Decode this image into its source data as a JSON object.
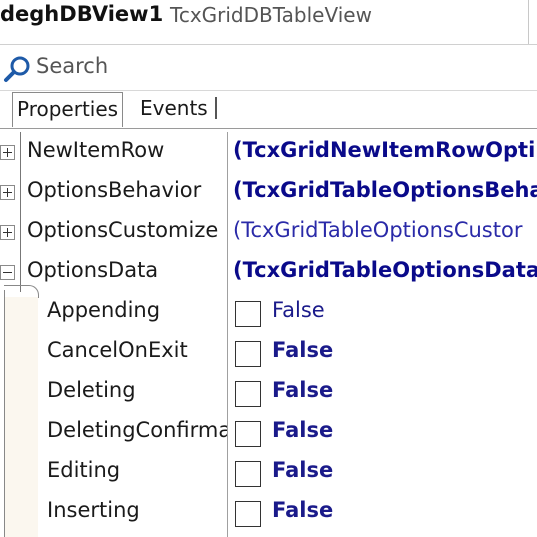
{
  "header": {
    "name": "deghDBView1",
    "type": "TcxGridDBTableView"
  },
  "search": {
    "placeholder": "Search"
  },
  "tabs": [
    {
      "label": "Properties",
      "active": true
    },
    {
      "label": "Events",
      "active": false
    }
  ],
  "properties": [
    {
      "name": "NewItemRow",
      "value": "(TcxGridNewItemRowOpti",
      "expander": "+",
      "bold": true
    },
    {
      "name": "OptionsBehavior",
      "value": "(TcxGridTableOptionsBehav",
      "expander": "+",
      "bold": true
    },
    {
      "name": "OptionsCustomize",
      "value": "(TcxGridTableOptionsCustor",
      "expander": "+",
      "bold": false
    },
    {
      "name": "OptionsData",
      "value": "(TcxGridTableOptionsData)",
      "expander": "-",
      "bold": true
    }
  ],
  "suboptions": [
    {
      "name": "Appending",
      "value": "False",
      "bold": false
    },
    {
      "name": "CancelOnExit",
      "value": "False",
      "bold": true
    },
    {
      "name": "Deleting",
      "value": "False",
      "bold": true
    },
    {
      "name": "DeletingConfirma",
      "value": "False",
      "bold": true
    },
    {
      "name": "Editing",
      "value": "False",
      "bold": true
    },
    {
      "name": "Inserting",
      "value": "False",
      "bold": true
    }
  ],
  "colors": {
    "value_text": "#0a0a8a",
    "accent": "#1e5aa8"
  }
}
